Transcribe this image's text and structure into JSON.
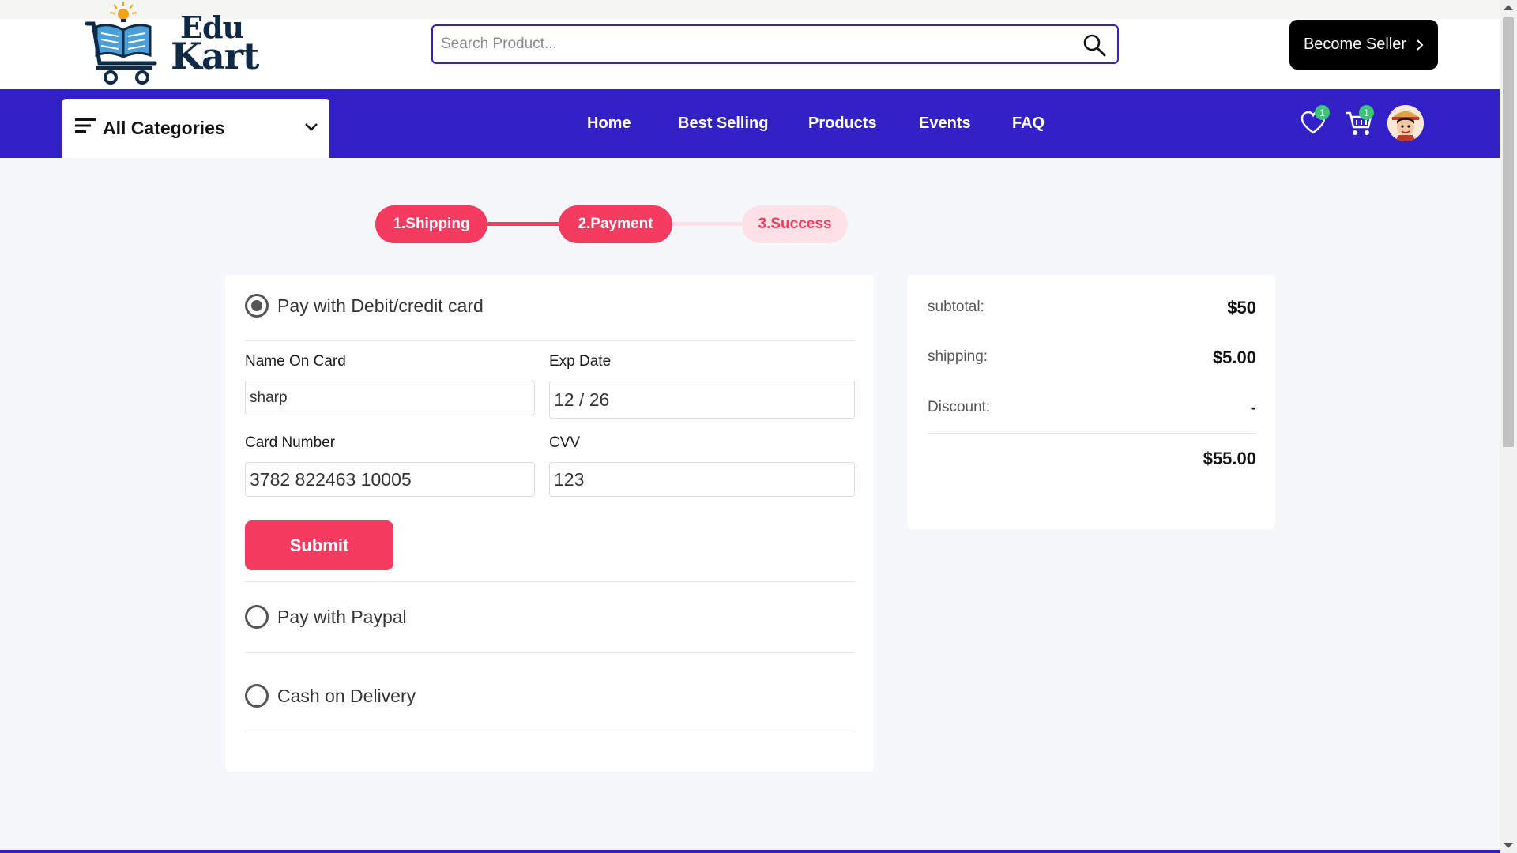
{
  "header": {
    "logo": {
      "line1": "Edu",
      "line2": "Kart"
    },
    "search": {
      "placeholder": "Search Product..."
    },
    "seller_button": "Become Seller"
  },
  "nav": {
    "categories_label": "All Categories",
    "links": [
      {
        "label": "Home"
      },
      {
        "label": "Best Selling"
      },
      {
        "label": "Products"
      },
      {
        "label": "Events"
      },
      {
        "label": "FAQ"
      }
    ],
    "wishlist_count": "1",
    "cart_count": "1"
  },
  "steps": [
    {
      "label": "1.Shipping",
      "state": "active"
    },
    {
      "label": "2.Payment",
      "state": "active"
    },
    {
      "label": "3.Success",
      "state": "inactive"
    }
  ],
  "payment": {
    "card_option": {
      "label": "Pay with Debit/credit card",
      "selected": true,
      "fields": {
        "name_label": "Name On Card",
        "name_value": "sharp",
        "exp_label": "Exp Date",
        "exp_value": "12 / 26",
        "number_label": "Card Number",
        "number_value": "3782 822463 10005",
        "cvv_label": "CVV",
        "cvv_value": "123"
      },
      "submit_label": "Submit"
    },
    "paypal_option": {
      "label": "Pay with Paypal",
      "selected": false
    },
    "cod_option": {
      "label": "Cash on Delivery",
      "selected": false
    }
  },
  "summary": {
    "subtotal_label": "subtotal:",
    "subtotal_value": "$50",
    "shipping_label": "shipping:",
    "shipping_value": "$5.00",
    "discount_label": "Discount:",
    "discount_value": "-",
    "total_value": "$55.00"
  },
  "colors": {
    "brand": "#3321c8",
    "accent": "#f63b60",
    "accent_light": "#fde1e6",
    "badge": "#3bc577"
  }
}
